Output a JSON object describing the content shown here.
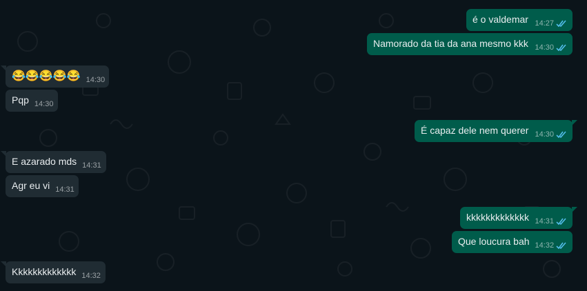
{
  "chat": {
    "messages": [
      {
        "dir": "out",
        "text": "é o valdemar",
        "time": "14:27",
        "status": "read"
      },
      {
        "dir": "out",
        "text": "Namorado da tia da ana mesmo kkk",
        "time": "14:30",
        "status": "read"
      },
      {
        "dir": "in",
        "text": "😂😂😂😂😂",
        "time": "14:30"
      },
      {
        "dir": "in",
        "text": "Pqp",
        "time": "14:30"
      },
      {
        "dir": "out",
        "text": "É capaz dele nem querer",
        "time": "14:30",
        "status": "read"
      },
      {
        "dir": "in",
        "text": "E azarado mds",
        "time": "14:31"
      },
      {
        "dir": "in",
        "text": "Agr eu vi",
        "time": "14:31"
      },
      {
        "dir": "out",
        "text": "kkkkkkkkkkkkk",
        "time": "14:31",
        "status": "read"
      },
      {
        "dir": "out",
        "text": "Que loucura bah",
        "time": "14:32",
        "status": "read"
      },
      {
        "dir": "in",
        "text": "Kkkkkkkkkkkkk",
        "time": "14:32"
      }
    ]
  },
  "colors": {
    "background": "#0b141a",
    "incoming_bubble": "#202c33",
    "outgoing_bubble": "#005c4b",
    "read_ticks": "#53bdeb",
    "text": "#e9edef"
  },
  "icons": {
    "read_status": "double-check-icon"
  }
}
